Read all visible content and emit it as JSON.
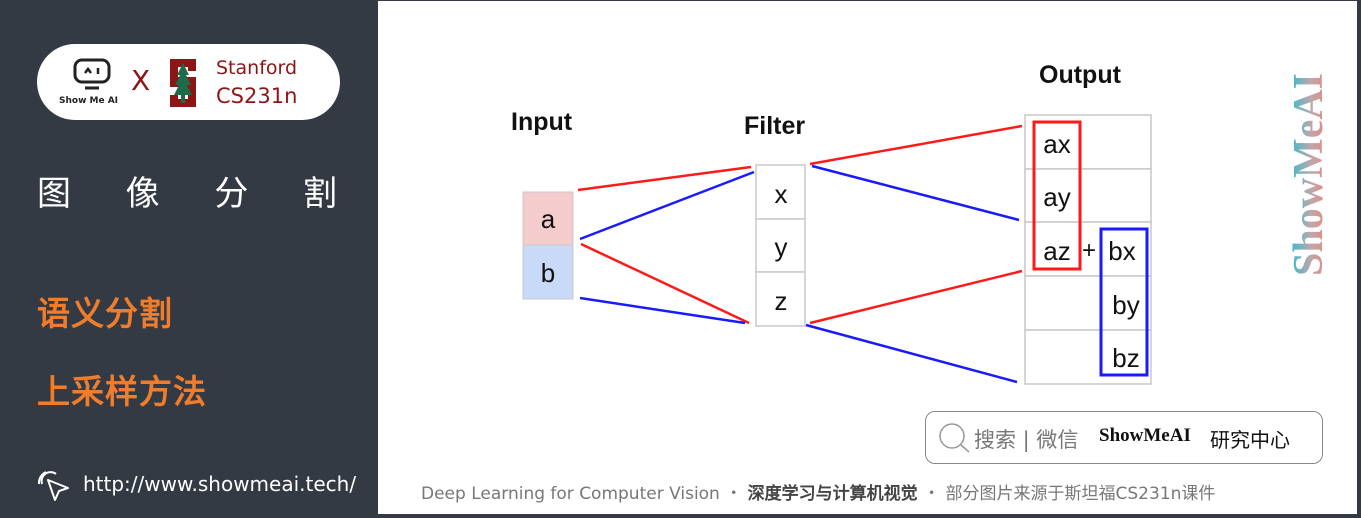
{
  "sidebar": {
    "logo": {
      "showmeai_text": "Show Me AI",
      "times": "X",
      "stanford_line1": "Stanford",
      "stanford_line2": "CS231n"
    },
    "chapter_title": [
      "图",
      "像",
      "分",
      "割"
    ],
    "topics": [
      "语义分割",
      "上采样方法"
    ],
    "url": "http://www.showmeai.tech/"
  },
  "diagram": {
    "input_label": "Input",
    "filter_label": "Filter",
    "output_label": "Output",
    "input_cells": [
      "a",
      "b"
    ],
    "filter_cells": [
      "x",
      "y",
      "z"
    ],
    "output_left": [
      "ax",
      "ay",
      "az",
      "",
      ""
    ],
    "plus": "+",
    "output_right": [
      "",
      "",
      "bx",
      "by",
      "bz"
    ],
    "colors": {
      "red": "#ff1a1a",
      "blue": "#1a1aff",
      "input_a_bg": "#f4cccc",
      "input_b_bg": "#c9daf8"
    }
  },
  "brand_vertical": "ShowMeAI",
  "search": {
    "label": "搜索 | 微信",
    "brand": "ShowMeAI",
    "suffix": "研究中心"
  },
  "footer": {
    "part1": "Deep Learning for Computer Vision",
    "sep": "・",
    "part2": "深度学习与计算机视觉",
    "part3": "部分图片来源于斯坦福CS231n课件"
  }
}
